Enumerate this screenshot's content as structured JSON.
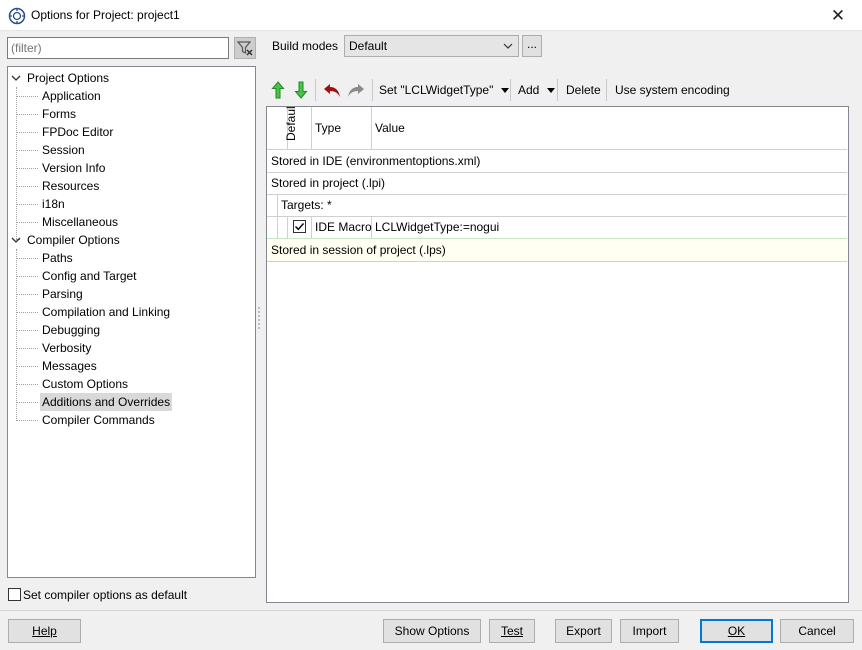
{
  "window": {
    "title": "Options for Project: project1"
  },
  "filter": {
    "placeholder": "(filter)"
  },
  "tree": {
    "groups": [
      {
        "label": "Project Options",
        "children": [
          "Application",
          "Forms",
          "FPDoc Editor",
          "Session",
          "Version Info",
          "Resources",
          "i18n",
          "Miscellaneous"
        ]
      },
      {
        "label": "Compiler Options",
        "children": [
          "Paths",
          "Config and Target",
          "Parsing",
          "Compilation and Linking",
          "Debugging",
          "Verbosity",
          "Messages",
          "Custom Options",
          "Additions and Overrides",
          "Compiler Commands"
        ]
      }
    ],
    "selected": "Additions and Overrides"
  },
  "default_checkbox": {
    "label": "Set compiler options as default",
    "checked": false
  },
  "build_modes": {
    "label": "Build modes",
    "value": "Default",
    "more_label": "..."
  },
  "toolbar": {
    "set_label": "Set \"LCLWidgetType\"",
    "add_label": "Add",
    "delete_label": "Delete",
    "encoding_label": "Use system encoding"
  },
  "grid": {
    "headers": {
      "default": "Default",
      "type": "Type",
      "value": "Value"
    },
    "sections": {
      "ide": "Stored in IDE (environmentoptions.xml)",
      "project": "Stored in project (.lpi)",
      "targets": "Targets: *",
      "session": "Stored in session of project (.lps)"
    },
    "macro_row": {
      "checked": true,
      "type": "IDE Macro",
      "value": "LCLWidgetType:=nogui"
    }
  },
  "buttons": {
    "help": "Help",
    "show_options": "Show Options",
    "test": "Test",
    "export": "Export",
    "import": "Import",
    "ok": "OK",
    "cancel": "Cancel"
  },
  "colors": {
    "accent": "#0078d7",
    "arrow_green": "#3cb43c",
    "undo_red": "#a01010"
  }
}
